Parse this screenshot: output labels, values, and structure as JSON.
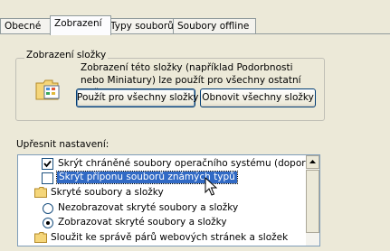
{
  "tabs": [
    {
      "label": "Obecné"
    },
    {
      "label": "Zobrazení"
    },
    {
      "label": "Typy souborů"
    },
    {
      "label": "Soubory offline"
    }
  ],
  "folder_view": {
    "title": "Zobrazení složky",
    "description": "Zobrazení této složky (například Podorbnosti nebo Miniatury) lze použít pro všechny ostatní složky.",
    "apply_all_label": "Použít pro všechny složky",
    "reset_all_label": "Obnovit všechny složky"
  },
  "advanced": {
    "label": "Upřesnit nastavení:",
    "items": [
      {
        "label": "Skrýt chráněné soubory operačního systému (doporučen",
        "type": "checkbox",
        "checked": true
      },
      {
        "label": "Skrýt příponu souborů známých typů",
        "type": "checkbox",
        "checked": false,
        "selected": true
      },
      {
        "label": "Skryté soubory a složky",
        "type": "folder"
      },
      {
        "label": "Nezobrazovat skryté soubory a složky",
        "type": "radio",
        "checked": false
      },
      {
        "label": "Zobrazovat skryté soubory a složky",
        "type": "radio",
        "checked": true
      },
      {
        "label": "Sloužit ke správě párů webových stránek a složek",
        "type": "folder"
      }
    ]
  },
  "icons": {
    "folder": "folder-icon",
    "cursor": "mouse-cursor-icon",
    "scroll_up": "scroll-up-arrow-icon"
  },
  "colors": {
    "panel_bg": "#ece9d8",
    "selection": "#316ac5",
    "border": "#7f9db9"
  }
}
